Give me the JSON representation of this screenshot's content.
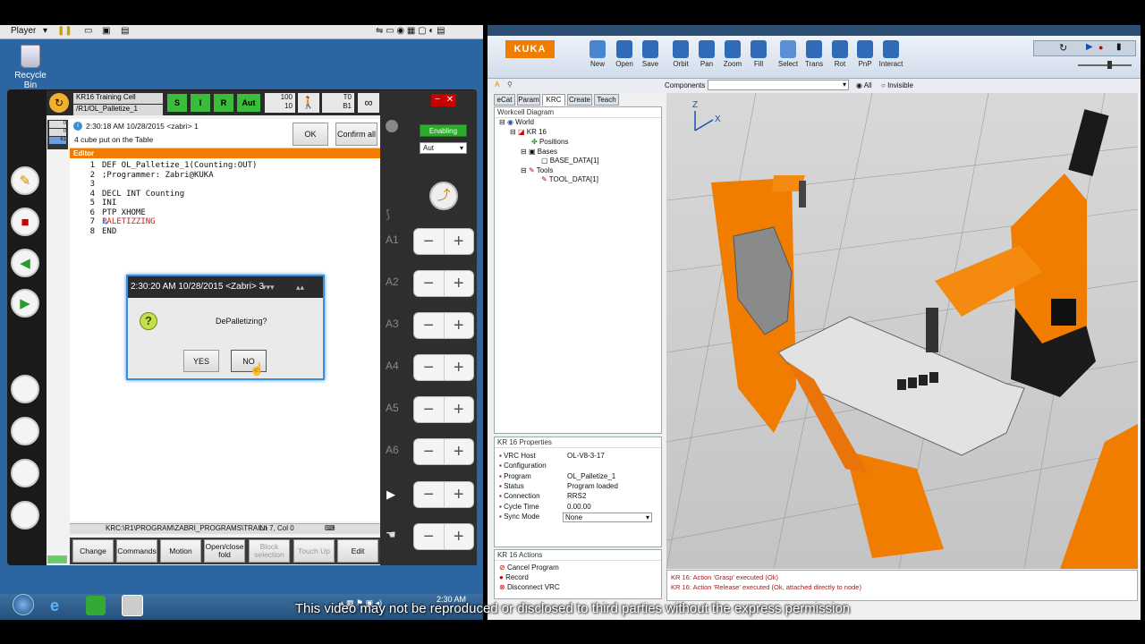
{
  "vm": {
    "player_label": "Player",
    "recycle_bin": "Recycle Bin",
    "clock": "2:30 AM"
  },
  "pad": {
    "cell_name": "KR16 Training Cell",
    "program_path": "/R1/OL_Palletize_1",
    "s_label": "S",
    "i_label": "I",
    "r_label": "R",
    "aut_label": "Aut",
    "override_top": "100",
    "override_bottom": "10",
    "tool_top": "T0",
    "tool_bottom": "B1",
    "infinity": "∞",
    "message_time": "2:30:18 AM 10/28/2015 <zabri> 1",
    "message_text": "4 cube put on the Table",
    "ok_label": "OK",
    "confirm_all_label": "Confirm all",
    "enabling_label": "Enabling",
    "mode_select": "Aut",
    "editor_title": "Editor",
    "code": [
      {
        "n": "1",
        "text": "DEF OL_Palletize_1(Counting:OUT)"
      },
      {
        "n": "2",
        "text": ";Programmer: Zabri@KUKA"
      },
      {
        "n": "3",
        "text": ""
      },
      {
        "n": "4",
        "text": "DECL INT Counting"
      },
      {
        "n": "5",
        "text": "INI"
      },
      {
        "n": "6",
        "text": "PTP XHOME"
      },
      {
        "n": "7",
        "text": "PALETIZZING"
      },
      {
        "n": "8",
        "text": "END"
      }
    ],
    "path_text": "KRC:\\R1\\PROGRAM\\ZABRI_PROGRAMS\\TRAINI",
    "cursor_pos": "Ln 7, Col 0",
    "softkeys": [
      "Change",
      "Commands",
      "Motion",
      "Open/close fold",
      "Block selection",
      "Touch Up",
      "Edit"
    ],
    "axes": [
      "A1",
      "A2",
      "A3",
      "A4",
      "A5",
      "A6"
    ],
    "jog_minus": "−",
    "jog_plus": "+"
  },
  "dialog": {
    "title": "2:30:20 AM 10/28/2015 <Zabri> 3",
    "question": "DePalletizing?",
    "yes_label": "YES",
    "no_label": "NO"
  },
  "workvisual": {
    "logo": "KUKA",
    "ribbon": [
      "New",
      "Open",
      "Save",
      "Orbit",
      "Pan",
      "Zoom",
      "Fill",
      "Select",
      "Trans",
      "Rot",
      "PnP",
      "Interact"
    ],
    "components_label": "Components",
    "filter_all": "All",
    "filter_invisible": "Invisible",
    "tabs": [
      "eCat",
      "Param",
      "KRC",
      "Create",
      "Teach"
    ],
    "workcell_title": "Workcell Diagram",
    "tree": [
      "World",
      "KR 16",
      "Positions",
      "Bases",
      "BASE_DATA[1]",
      "Tools",
      "TOOL_DATA[1]"
    ],
    "props_title": "KR 16 Properties",
    "props": [
      {
        "k": "VRC Host",
        "v": "OL-V8-3-17"
      },
      {
        "k": "Configuration",
        "v": ""
      },
      {
        "k": "Program",
        "v": "OL_Palletize_1"
      },
      {
        "k": "Status",
        "v": "Program loaded"
      },
      {
        "k": "Connection",
        "v": "RRS2"
      },
      {
        "k": "Cycle Time",
        "v": "0.00.00"
      },
      {
        "k": "Sync Mode",
        "v": "None"
      }
    ],
    "actions_title": "KR 16 Actions",
    "actions": [
      "Cancel Program",
      "Record",
      "Disconnect VRC"
    ],
    "axis_z": "Z",
    "axis_x": "X",
    "log": [
      "KR 16: Action 'Grasp' executed (Ok)",
      "KR 16: Action 'Release' executed (Ok, attached directly to node)"
    ]
  },
  "subtitle": "This video may not be reproduced or disclosed to third parties without the express permission",
  "colors": {
    "kuka_orange": "#f07c00",
    "status_green": "#3cbc3c",
    "dialog_border": "#3b8fd8"
  }
}
